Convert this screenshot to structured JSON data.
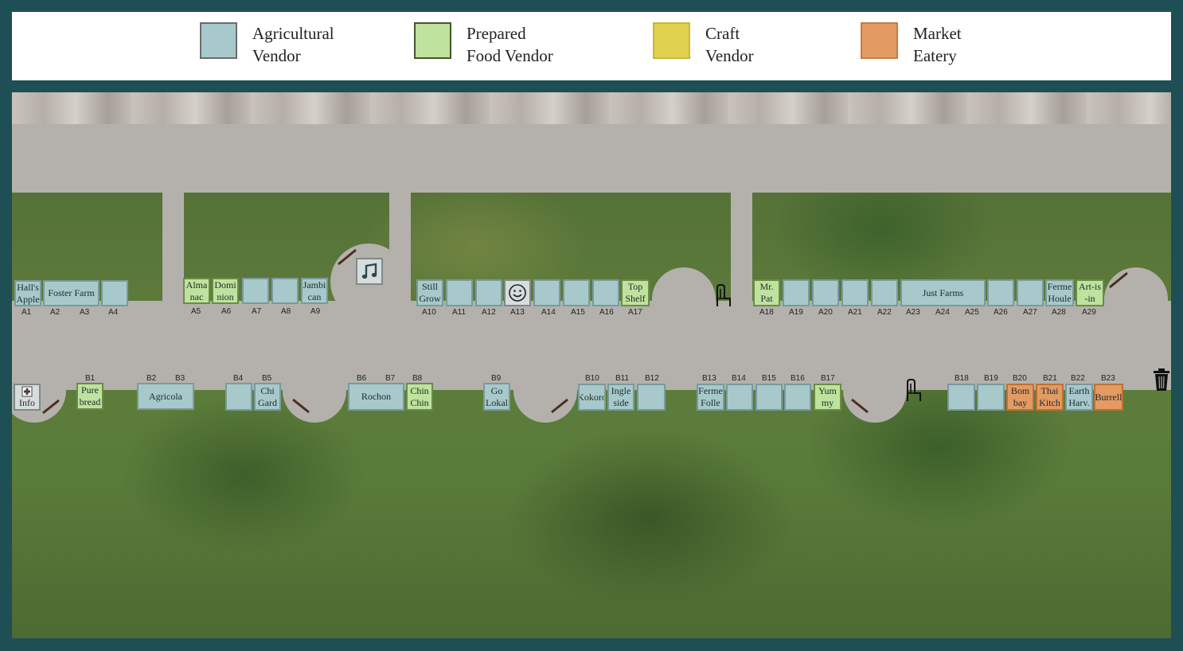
{
  "legend": [
    {
      "line1": "Agricultural",
      "line2": "Vendor",
      "color": "#a7c9cb"
    },
    {
      "line1": "Prepared",
      "line2": "Food Vendor",
      "color": "#bfe29f"
    },
    {
      "line1": "Craft",
      "line2": "Vendor",
      "color": "#e0d24f"
    },
    {
      "line1": "Market",
      "line2": "Eatery",
      "color": "#e39a63"
    }
  ],
  "stalls": {
    "halls_apple": "Hall's Apple",
    "foster_farm": "Foster Farm",
    "almanac": "Alma nac",
    "dominion": "Domi nion",
    "jambican": "Jambi can",
    "still_grow": "Still Grow",
    "top_shelf": "Top Shelf",
    "mr_pat": "Mr. Pat",
    "just_farms": "Just Farms",
    "ferme_houle": "Ferme Houle",
    "art_is_in": "Art-is -in",
    "info": "Info",
    "purebread": "Pure bread",
    "agricola": "Agricola",
    "chi_gard": "Chi Gard",
    "rochon": "Rochon",
    "chin_chin": "Chin Chin",
    "go_lokal": "Go Lokal",
    "kokoro": "Kokoro",
    "ingleside": "Ingle side",
    "ferme_folle": "Ferme Folle",
    "yummy": "Yum my",
    "bombay": "Bom bay",
    "thai_kitch": "Thai Kitch",
    "earth_harv": "Earth Harv.",
    "burrell": "Burrell"
  },
  "codes": {
    "A1": "A1",
    "A2": "A2",
    "A3": "A3",
    "A4": "A4",
    "A5": "A5",
    "A6": "A6",
    "A7": "A7",
    "A8": "A8",
    "A9": "A9",
    "A10": "A10",
    "A11": "A11",
    "A12": "A12",
    "A13": "A13",
    "A14": "A14",
    "A15": "A15",
    "A16": "A16",
    "A17": "A17",
    "A18": "A18",
    "A19": "A19",
    "A20": "A20",
    "A21": "A21",
    "A22": "A22",
    "A23": "A23",
    "A24": "A24",
    "A25": "A25",
    "A26": "A26",
    "A27": "A27",
    "A28": "A28",
    "A29": "A29",
    "B1": "B1",
    "B2": "B2",
    "B3": "B3",
    "B4": "B4",
    "B5": "B5",
    "B6": "B6",
    "B7": "B7",
    "B8": "B8",
    "B9": "B9",
    "B10": "B10",
    "B11": "B11",
    "B12": "B12",
    "B13": "B13",
    "B14": "B14",
    "B15": "B15",
    "B16": "B16",
    "B17": "B17",
    "B18": "B18",
    "B19": "B19",
    "B20": "B20",
    "B21": "B21",
    "B22": "B22",
    "B23": "B23"
  },
  "icons": {
    "music": "music-note-icon",
    "smiley": "smiley-icon",
    "trash": "trash-can-icon",
    "first_aid": "first-aid-icon",
    "chair": "chair-icon",
    "bench": "bench-icon"
  }
}
